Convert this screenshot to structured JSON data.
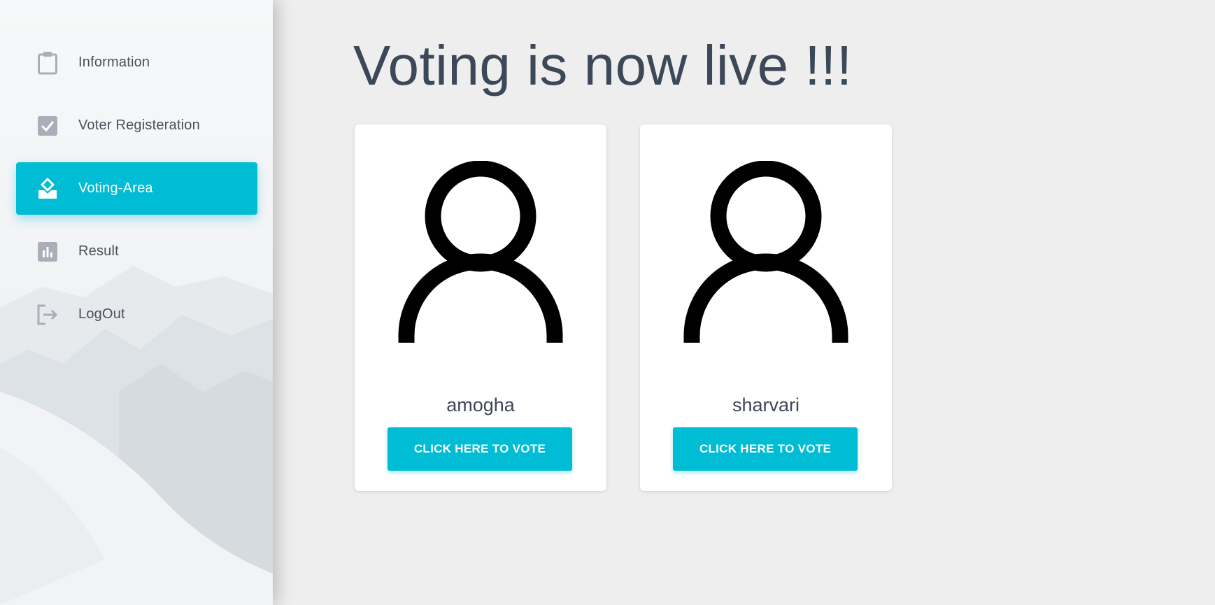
{
  "sidebar": {
    "items": [
      {
        "label": "Information",
        "icon": "clipboard-icon",
        "active": false
      },
      {
        "label": "Voter Registeration",
        "icon": "checkbox-icon",
        "active": false
      },
      {
        "label": "Voting-Area",
        "icon": "ballot-box-icon",
        "active": true
      },
      {
        "label": "Result",
        "icon": "bar-chart-icon",
        "active": false
      },
      {
        "label": "LogOut",
        "icon": "logout-icon",
        "active": false
      }
    ]
  },
  "main": {
    "title": "Voting is now live !!!",
    "candidates": [
      {
        "name": "amogha",
        "button_label": "CLICK HERE TO VOTE",
        "avatar_icon": "person-icon"
      },
      {
        "name": "sharvari",
        "button_label": "CLICK HERE TO VOTE",
        "avatar_icon": "person-icon"
      }
    ]
  },
  "colors": {
    "accent": "#00bcd4",
    "title_text": "#3c4858",
    "nav_text": "#4b4f58",
    "icon_gray": "#a9aeb8",
    "page_bg": "#eeeeee"
  }
}
